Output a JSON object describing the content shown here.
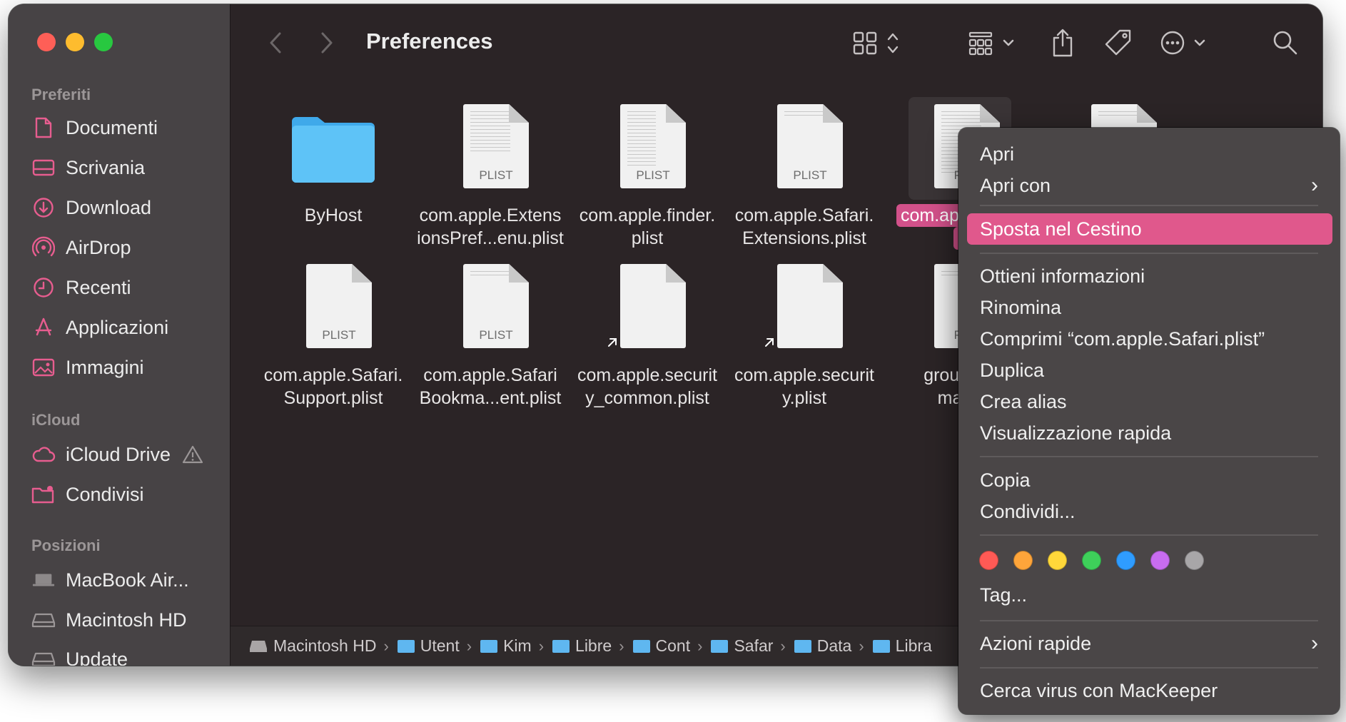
{
  "toolbar": {
    "title": "Preferences"
  },
  "sidebar": {
    "favorites_heading": "Preferiti",
    "favorites": [
      {
        "label": "Documenti"
      },
      {
        "label": "Scrivania"
      },
      {
        "label": "Download"
      },
      {
        "label": "AirDrop"
      },
      {
        "label": "Recenti"
      },
      {
        "label": "Applicazioni"
      },
      {
        "label": "Immagini"
      }
    ],
    "icloud_heading": "iCloud",
    "icloud": [
      {
        "label": "iCloud Drive"
      },
      {
        "label": "Condivisi"
      }
    ],
    "locations_heading": "Posizioni",
    "locations": [
      {
        "label": "MacBook Air..."
      },
      {
        "label": "Macintosh HD"
      },
      {
        "label": "Update"
      }
    ]
  },
  "files": [
    {
      "line1": "ByHost",
      "line2": "",
      "kind": "folder"
    },
    {
      "line1": "com.apple.Extens",
      "line2": "ionsPref...enu.plist",
      "kind": "plist",
      "badge": "PLIST"
    },
    {
      "line1": "com.apple.finder.",
      "line2": "plist",
      "kind": "plist",
      "badge": "PLIST"
    },
    {
      "line1": "com.apple.Safari.",
      "line2": "Extensions.plist",
      "kind": "plist",
      "badge": "PLIST"
    },
    {
      "line1": "com.apple",
      "line2": "plis",
      "kind": "plist",
      "badge": "PLIS",
      "selected": true
    },
    {
      "line1": "com.apple.Safari.",
      "line2": "Support.plist",
      "kind": "plist",
      "badge": "PLIST"
    },
    {
      "line1": "com.apple.Safari",
      "line2": "Bookma...ent.plist",
      "kind": "plist",
      "badge": "PLIST"
    },
    {
      "line1": "com.apple.securit",
      "line2": "y_common.plist",
      "kind": "alias"
    },
    {
      "line1": "com.apple.securit",
      "line2": "y.plist",
      "kind": "alias"
    },
    {
      "line1": "group.cor",
      "line2": "mail.p",
      "kind": "plist",
      "badge": "PLIS"
    }
  ],
  "pathbar": [
    {
      "label": "Macintosh HD"
    },
    {
      "label": "Utent"
    },
    {
      "label": "Kim"
    },
    {
      "label": "Libre"
    },
    {
      "label": "Cont"
    },
    {
      "label": "Safar"
    },
    {
      "label": "Data"
    },
    {
      "label": "Libra"
    }
  ],
  "context_menu": {
    "open": "Apri",
    "open_with": "Apri con",
    "move_to_trash": "Sposta nel Cestino",
    "get_info": "Ottieni informazioni",
    "rename": "Rinomina",
    "compress": "Comprimi “com.apple.Safari.plist”",
    "duplicate": "Duplica",
    "make_alias": "Crea alias",
    "quick_look": "Visualizzazione rapida",
    "copy": "Copia",
    "share": "Condividi...",
    "tag_colors": [
      "#ff5a55",
      "#ffa53a",
      "#ffd83a",
      "#3ed05a",
      "#2f9cff",
      "#c86cf0",
      "#a8a6a8"
    ],
    "tags": "Tag...",
    "quick_actions": "Azioni rapide",
    "virus_scan": "Cerca virus con MacKeeper"
  }
}
